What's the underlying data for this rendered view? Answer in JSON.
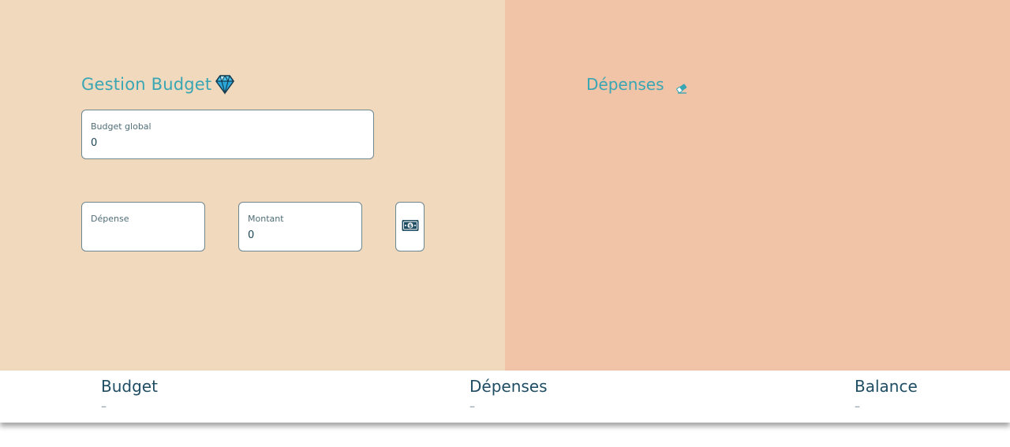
{
  "app": {
    "title": "Gestion Budget",
    "title_icon": "gem-icon",
    "accent_color": "#3aa6b4",
    "left_bg": "#f1d9bd",
    "right_bg": "#f1c3a7"
  },
  "form": {
    "budget_label": "Budget global",
    "budget_value": "0",
    "depense_label": "Dépense",
    "depense_value": "",
    "montant_label": "Montant",
    "montant_value": "0",
    "add_button_icon": "money-bill-icon"
  },
  "expenses_panel": {
    "title": "Dépenses",
    "clear_icon": "eraser-icon"
  },
  "summary": {
    "budget_label": "Budget",
    "budget_value": "–",
    "depenses_label": "Dépenses",
    "depenses_value": "–",
    "balance_label": "Balance",
    "balance_value": "–"
  }
}
